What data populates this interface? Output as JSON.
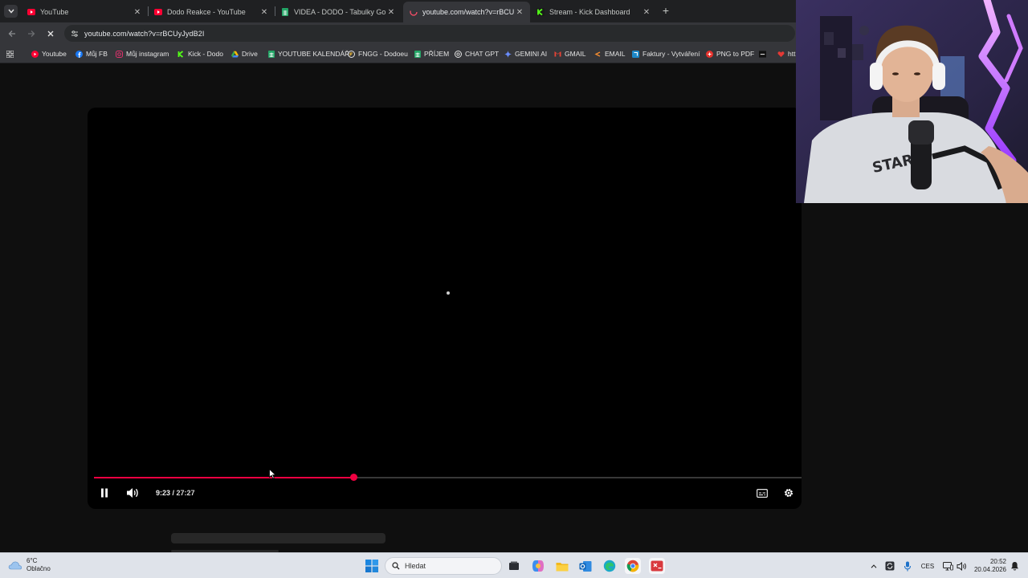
{
  "browser": {
    "tabs": [
      {
        "title": "YouTube",
        "icon": "youtube-icon"
      },
      {
        "title": "Dodo Reakce - YouTube",
        "icon": "youtube-icon"
      },
      {
        "title": "VIDEA - DODO - Tabulky Googl",
        "icon": "google-sheets-icon"
      },
      {
        "title": "youtube.com/watch?v=rBCUyJy",
        "icon": "youtube-icon",
        "active": true
      },
      {
        "title": "Stream - Kick Dashboard",
        "icon": "kick-icon"
      }
    ],
    "url": "youtube.com/watch?v=rBCUyJydB2I",
    "bookmarks": [
      {
        "label": "Youtube",
        "icon": "youtube-icon"
      },
      {
        "label": "Můj FB",
        "icon": "facebook-icon"
      },
      {
        "label": "Můj instagram",
        "icon": "instagram-icon"
      },
      {
        "label": "Kick - Dodo",
        "icon": "kick-icon"
      },
      {
        "label": "Drive",
        "icon": "google-drive-icon"
      },
      {
        "label": "YOUTUBE KALENDÁŘ",
        "icon": "google-sheets-icon"
      },
      {
        "label": "FNGG - Dodoeu",
        "icon": "fngg-icon"
      },
      {
        "label": "PŘÍJEM",
        "icon": "google-sheets-icon"
      },
      {
        "label": "CHAT GPT",
        "icon": "chatgpt-icon"
      },
      {
        "label": "GEMINI AI",
        "icon": "gemini-icon"
      },
      {
        "label": "GMAIL",
        "icon": "gmail-icon"
      },
      {
        "label": "EMAIL",
        "icon": "email-icon"
      },
      {
        "label": "Faktury - Vytváření",
        "icon": "invoice-icon"
      },
      {
        "label": "PNG to PDF",
        "icon": "png-to-pdf-icon"
      },
      {
        "label": "",
        "icon": "dash-icon"
      },
      {
        "label": "htt",
        "icon": "heart-icon"
      }
    ]
  },
  "player": {
    "current_time": "9:23",
    "separator": " / ",
    "duration": "27:27",
    "progress": 0.367,
    "state": "playing",
    "accent_color": "#f00041"
  },
  "taskbar": {
    "weather_temp": "6°C",
    "weather_desc": "Oblačno",
    "search_placeholder": "Hledat",
    "language": "CES",
    "time": "20:52",
    "date": "20.04.2026"
  }
}
